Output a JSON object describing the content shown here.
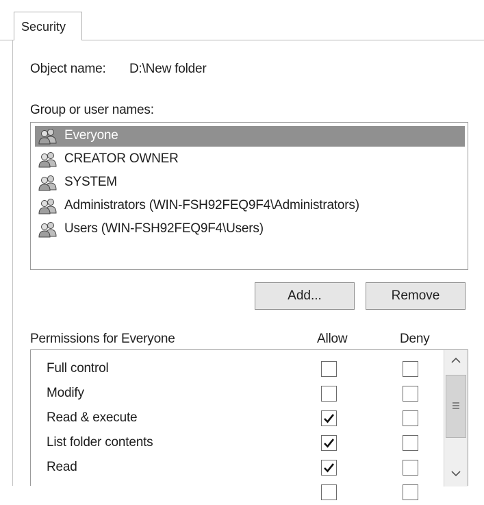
{
  "tab": {
    "label": "Security"
  },
  "object": {
    "label": "Object name:",
    "value": "D:\\New folder"
  },
  "groups": {
    "label": "Group or user names:",
    "items": [
      {
        "label": "Everyone",
        "selected": true,
        "icon": "users-icon"
      },
      {
        "label": "CREATOR OWNER",
        "selected": false,
        "icon": "users-icon"
      },
      {
        "label": "SYSTEM",
        "selected": false,
        "icon": "users-icon"
      },
      {
        "label": "Administrators (WIN-FSH92FEQ9F4\\Administrators)",
        "selected": false,
        "icon": "users-icon"
      },
      {
        "label": "Users (WIN-FSH92FEQ9F4\\Users)",
        "selected": false,
        "icon": "users-icon"
      }
    ]
  },
  "buttons": {
    "add": "Add...",
    "remove": "Remove"
  },
  "permissions": {
    "label": "Permissions for Everyone",
    "allow_header": "Allow",
    "deny_header": "Deny",
    "rows": [
      {
        "label": "Full control",
        "allow": false,
        "deny": false
      },
      {
        "label": "Modify",
        "allow": false,
        "deny": false
      },
      {
        "label": "Read & execute",
        "allow": true,
        "deny": false
      },
      {
        "label": "List folder contents",
        "allow": true,
        "deny": false
      },
      {
        "label": "Read",
        "allow": true,
        "deny": false
      }
    ]
  },
  "colors": {
    "selection": "#909090",
    "button_face": "#e6e6e6",
    "border": "#9a9a9a"
  }
}
